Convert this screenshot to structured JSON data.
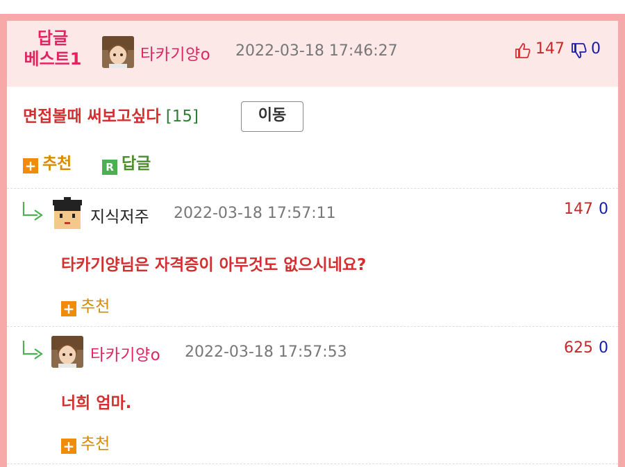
{
  "post": {
    "badge_line1": "답글",
    "badge_line2": "베스트1",
    "author": "타카기양o",
    "date": "2022-03-18 17:46:27",
    "upvotes": "147",
    "downvotes": "0",
    "title": "면접볼때 써보고싶다",
    "comment_count": "[15]",
    "move_label": "이동",
    "recommend_label": "추천",
    "reply_label": "답글",
    "reply_icon_letter": "R"
  },
  "replies": [
    {
      "author": "지식저주",
      "date": "2022-03-18 17:57:11",
      "upvotes": "147",
      "downvotes": "0",
      "text": "타카기양님은 자격증이 아무것도 없으시네요?",
      "recommend_label": "추천"
    },
    {
      "author": "타카기양o",
      "date": "2022-03-18 17:57:53",
      "upvotes": "625",
      "downvotes": "0",
      "text": "너희 엄마.",
      "recommend_label": "추천"
    }
  ],
  "colors": {
    "frame": "#f7a9aa",
    "header_bg": "#fde8e8",
    "accent_pink": "#e0245e",
    "title_red": "#d32f2f",
    "recommend_orange": "#f08c0a",
    "reply_green": "#4caf50"
  },
  "icons": [
    "thumb-up-icon",
    "thumb-down-icon",
    "plus-icon",
    "reply-r-icon",
    "reply-arrow-icon"
  ]
}
